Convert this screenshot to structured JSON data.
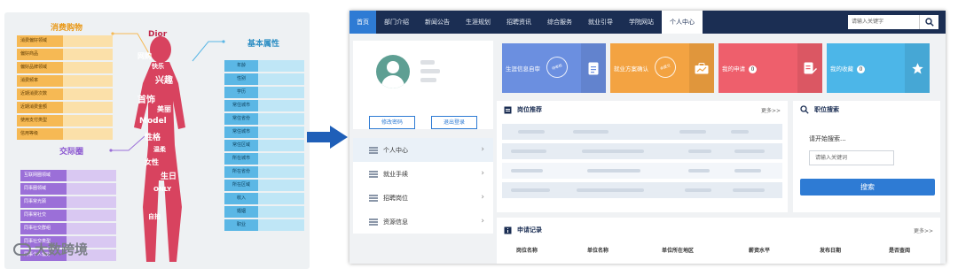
{
  "diagram": {
    "consumption_title": "消费购物",
    "consumption_rows": [
      "消费偏好领域",
      "偏好商品",
      "偏好品牌领域",
      "消费频率",
      "近期消费次数",
      "近期消费金额",
      "使用支付类型",
      "信用等级"
    ],
    "transaction_title": "交际圈",
    "transaction_rows": [
      "互联网圈领域",
      "同事圈领域",
      "同事常光顾",
      "同事常社交",
      "同事社交群组",
      "同事社交类型",
      "同事个人偏好"
    ],
    "basic_title": "基本属性",
    "basic_rows": [
      "年龄",
      "性别",
      "学历",
      "常住城市",
      "常住省份",
      "常住城市",
      "常住区域",
      "所在城市",
      "所在省份",
      "所在区域",
      "收入",
      "婚姻",
      "职业"
    ],
    "word_cloud": [
      "Dior",
      "网购",
      "快乐",
      "兴趣",
      "首饰",
      "美丽",
      "Model",
      "性格",
      "温柔",
      "女性",
      "生日",
      "ONLY",
      "自拍"
    ],
    "brand": "大数跨境"
  },
  "app": {
    "nav": {
      "items": [
        "首页",
        "部门介绍",
        "新闻公告",
        "生涯规划",
        "招聘资讯",
        "综合服务",
        "就业引导",
        "学院网站",
        "个人中心"
      ],
      "active": "个人中心",
      "search_placeholder": "请输入关键字"
    },
    "user": {
      "edit_button": "修改密码",
      "logout_button": "退出登录"
    },
    "menu": [
      {
        "label": "个人中心"
      },
      {
        "label": "就业手续"
      },
      {
        "label": "招聘岗位"
      },
      {
        "label": "资源信息"
      }
    ],
    "tiles": [
      {
        "label": "生涯信息自审",
        "stamp": "待审核",
        "color": "#6b8fe0"
      },
      {
        "label": "就业方案确认",
        "stamp": "未提交",
        "color": "#f3a342"
      },
      {
        "label": "我的申请",
        "count": "0",
        "color": "#ee5f6c"
      },
      {
        "label": "我的收藏",
        "count": "0",
        "color": "#4cb6e8"
      }
    ],
    "jobs": {
      "title": "岗位推荐",
      "more": "更多>>"
    },
    "job_search": {
      "title": "职位搜索",
      "prompt": "请开始搜索...",
      "placeholder": "请输入关键词",
      "button": "搜索"
    },
    "records": {
      "title": "申请记录",
      "more": "更多>>",
      "columns": [
        "岗位名称",
        "单位名称",
        "单位所在地区",
        "薪资水平",
        "发布日期",
        "是否查阅"
      ]
    },
    "colors": {
      "nav_bg": "#1b2e53",
      "accent": "#2e7bd4"
    }
  }
}
